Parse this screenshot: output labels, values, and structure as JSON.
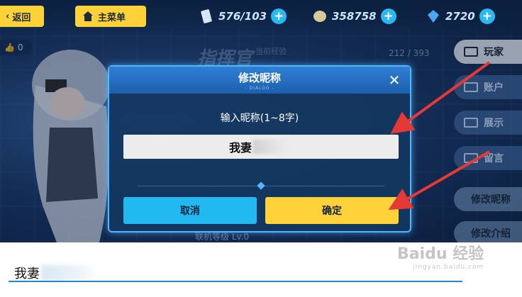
{
  "topbar": {
    "back_label": "返回",
    "home_label": "主菜单",
    "stamina": "576/103",
    "coins": "358758",
    "crystals": "2720"
  },
  "profile": {
    "likes": "0",
    "rank_title": "指挥官",
    "level_caption": "当前经验",
    "xp": "212 / 393",
    "bottom_line": "联机等级 Lv.0"
  },
  "sidebar": {
    "items": [
      {
        "label": "玩家"
      },
      {
        "label": "账户"
      },
      {
        "label": "展示"
      },
      {
        "label": "留言"
      },
      {
        "label": "修改昵称"
      },
      {
        "label": "修改介绍"
      }
    ]
  },
  "dialog": {
    "title": "修改昵称",
    "subtitle": "- DIALOG -",
    "prompt": "输入昵称(1~8字)",
    "input_value": "我妻",
    "cancel_label": "取消",
    "confirm_label": "确定"
  },
  "caption": {
    "text": "我妻"
  },
  "watermark": {
    "brand": "Baidu 经验",
    "url": "jingyan.baidu.com"
  },
  "colors": {
    "accent_yellow": "#ffd23a",
    "accent_blue": "#22b8f0",
    "annotation_red": "#e53935"
  }
}
